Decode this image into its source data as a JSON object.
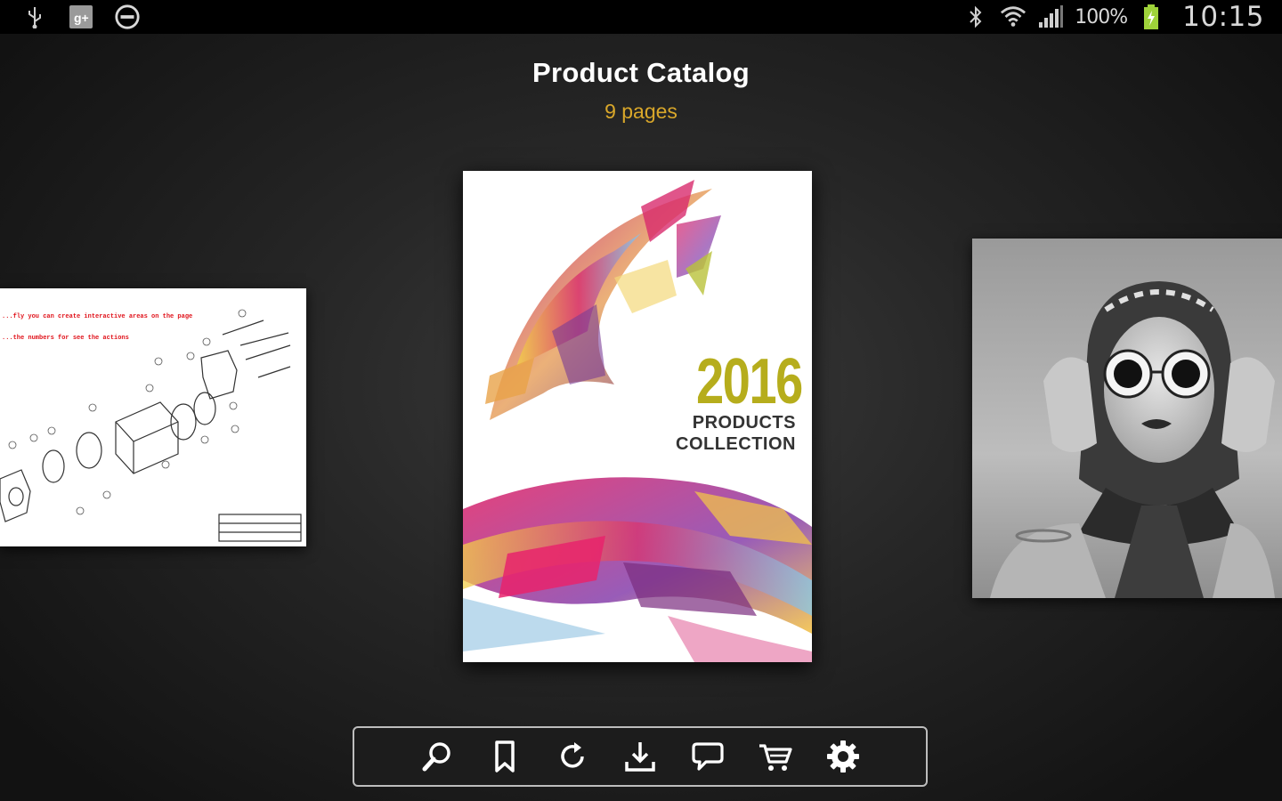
{
  "status_bar": {
    "battery_percent": "100%",
    "clock": "10:15",
    "icons_left": [
      "usb-icon",
      "google-plus-icon",
      "do-not-disturb-icon"
    ],
    "icons_right": [
      "bluetooth-icon",
      "wifi-icon",
      "signal-icon",
      "battery-icon"
    ]
  },
  "header": {
    "title": "Product Catalog",
    "page_count": "9 pages"
  },
  "pages": {
    "left": {
      "line1": "...fly you can create interactive areas on the page",
      "line2": "...the numbers for see the actions"
    },
    "center": {
      "year": "2016",
      "line1": "PRODUCTS",
      "line2": "COLLECTION"
    }
  },
  "toolbar": {
    "buttons": [
      "search-icon",
      "bookmark-icon",
      "refresh-icon",
      "download-icon",
      "comment-icon",
      "cart-icon",
      "settings-icon"
    ]
  },
  "colors": {
    "accent": "#d9a72a",
    "year": "#b6ad1c",
    "background": "#262626"
  }
}
